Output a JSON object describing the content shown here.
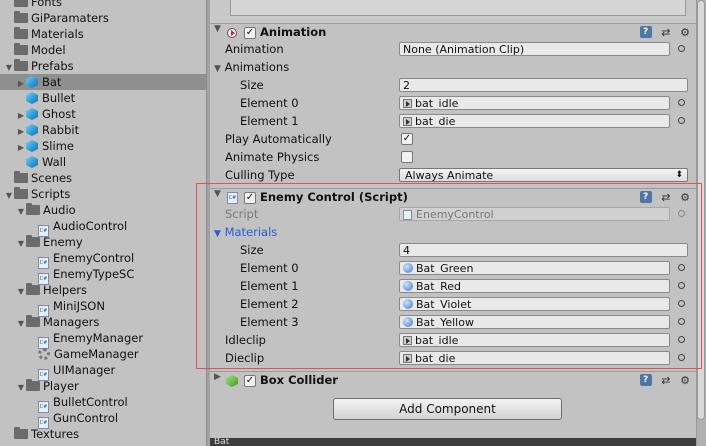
{
  "project": {
    "items": [
      {
        "label": "Fonts",
        "kind": "folder",
        "indent": 0,
        "expand": ""
      },
      {
        "label": "GiParamaters",
        "kind": "folder",
        "indent": 0,
        "expand": ""
      },
      {
        "label": "Materials",
        "kind": "folder",
        "indent": 0,
        "expand": ""
      },
      {
        "label": "Model",
        "kind": "folder",
        "indent": 0,
        "expand": ""
      },
      {
        "label": "Prefabs",
        "kind": "folder",
        "indent": 0,
        "expand": "▼"
      },
      {
        "label": "Bat",
        "kind": "cube",
        "indent": 1,
        "expand": "▶",
        "selected": true
      },
      {
        "label": "Bullet",
        "kind": "cube",
        "indent": 1,
        "expand": ""
      },
      {
        "label": "Ghost",
        "kind": "cube",
        "indent": 1,
        "expand": "▶"
      },
      {
        "label": "Rabbit",
        "kind": "cube",
        "indent": 1,
        "expand": "▶"
      },
      {
        "label": "Slime",
        "kind": "cube",
        "indent": 1,
        "expand": "▶"
      },
      {
        "label": "Wall",
        "kind": "cube",
        "indent": 1,
        "expand": ""
      },
      {
        "label": "Scenes",
        "kind": "folder",
        "indent": 0,
        "expand": ""
      },
      {
        "label": "Scripts",
        "kind": "folder",
        "indent": 0,
        "expand": "▼"
      },
      {
        "label": "Audio",
        "kind": "folder",
        "indent": 1,
        "expand": "▼"
      },
      {
        "label": "AudioControl",
        "kind": "cs",
        "indent": 2,
        "expand": ""
      },
      {
        "label": "Enemy",
        "kind": "folder",
        "indent": 1,
        "expand": "▼"
      },
      {
        "label": "EnemyControl",
        "kind": "cs",
        "indent": 2,
        "expand": ""
      },
      {
        "label": "EnemyTypeSC",
        "kind": "cs",
        "indent": 2,
        "expand": ""
      },
      {
        "label": "Helpers",
        "kind": "folder",
        "indent": 1,
        "expand": "▼"
      },
      {
        "label": "MiniJSON",
        "kind": "cs",
        "indent": 2,
        "expand": ""
      },
      {
        "label": "Managers",
        "kind": "folder",
        "indent": 1,
        "expand": "▼"
      },
      {
        "label": "EnemyManager",
        "kind": "cs",
        "indent": 2,
        "expand": ""
      },
      {
        "label": "GameManager",
        "kind": "gear",
        "indent": 2,
        "expand": ""
      },
      {
        "label": "UIManager",
        "kind": "cs",
        "indent": 2,
        "expand": ""
      },
      {
        "label": "Player",
        "kind": "folder",
        "indent": 1,
        "expand": "▼"
      },
      {
        "label": "BulletControl",
        "kind": "cs",
        "indent": 2,
        "expand": ""
      },
      {
        "label": "GunControl",
        "kind": "cs",
        "indent": 2,
        "expand": ""
      },
      {
        "label": "Textures",
        "kind": "folder",
        "indent": 0,
        "expand": ""
      }
    ]
  },
  "animation": {
    "title": "Animation",
    "enabled": true,
    "animation_label": "Animation",
    "animation_value": "None (Animation Clip)",
    "animations_label": "Animations",
    "size_label": "Size",
    "size_value": "2",
    "element0_label": "Element 0",
    "element0_value": "bat_idle",
    "element1_label": "Element 1",
    "element1_value": "bat_die",
    "play_auto_label": "Play Automatically",
    "play_auto_checked": true,
    "physics_label": "Animate Physics",
    "physics_checked": false,
    "culling_label": "Culling Type",
    "culling_value": "Always Animate"
  },
  "enemy_control": {
    "title": "Enemy Control (Script)",
    "enabled": true,
    "script_label": "Script",
    "script_value": "EnemyControl",
    "materials_label": "Materials",
    "size_label": "Size",
    "size_value": "4",
    "elements": [
      {
        "label": "Element 0",
        "value": "Bat_Green"
      },
      {
        "label": "Element 1",
        "value": "Bat_Red"
      },
      {
        "label": "Element 2",
        "value": "Bat_Violet"
      },
      {
        "label": "Element 3",
        "value": "Bat_Yellow"
      }
    ],
    "idle_label": "Idleclip",
    "idle_value": "bat_idle",
    "die_label": "Dieclip",
    "die_value": "bat_die"
  },
  "box_collider": {
    "title": "Box Collider",
    "enabled": true
  },
  "add_component_label": "Add Component",
  "bottom_label": "Bat",
  "highlight_color": "#e05353"
}
